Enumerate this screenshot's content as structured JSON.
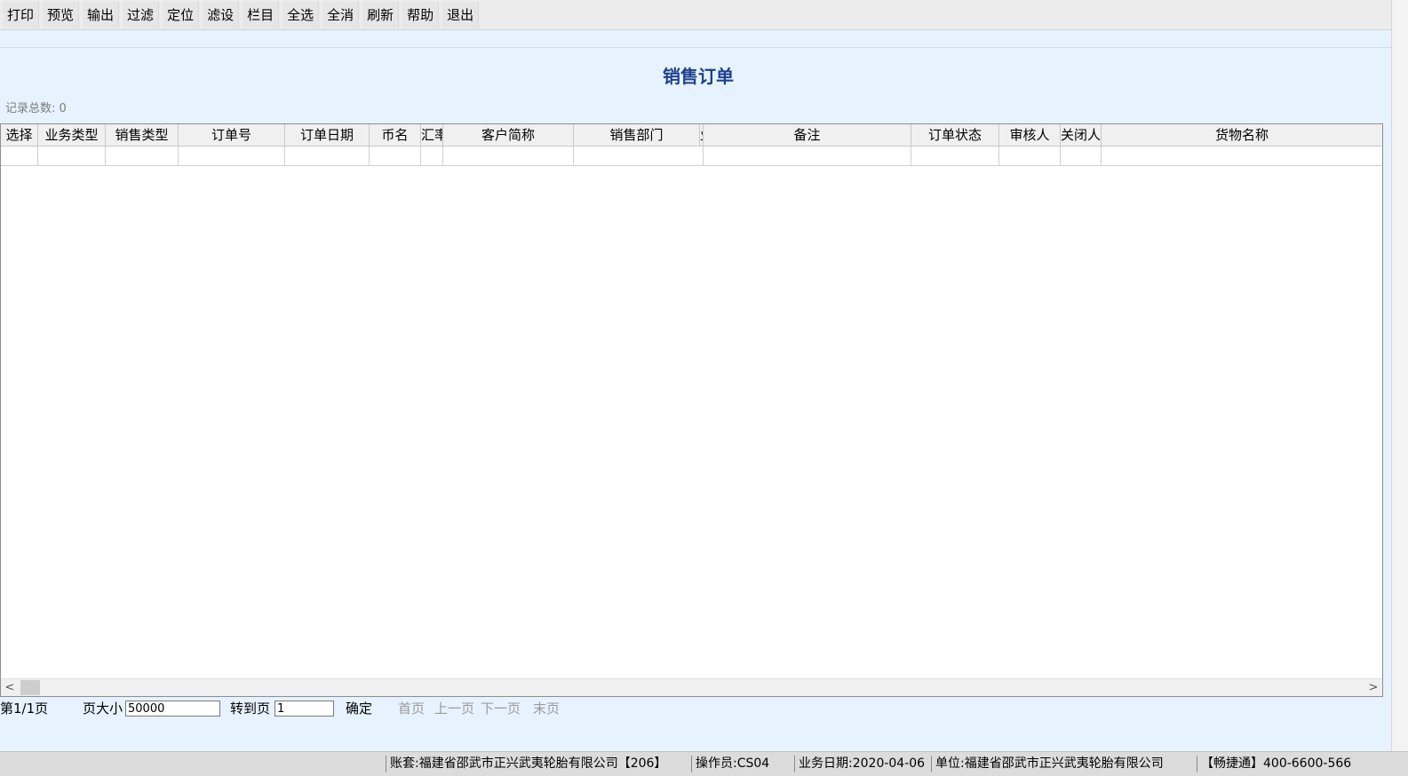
{
  "toolbar": {
    "buttons": [
      "打印",
      "预览",
      "输出",
      "过滤",
      "定位",
      "滤设",
      "栏目",
      "全选",
      "全消",
      "刷新",
      "帮助",
      "退出"
    ]
  },
  "title": "销售订单",
  "record_count_label": "记录总数: 0",
  "grid": {
    "columns": [
      "选择",
      "业务类型",
      "销售类型",
      "订单号",
      "订单日期",
      "币名",
      "汇率",
      "客户简称",
      "销售部门",
      "业务员",
      "备注",
      "订单状态",
      "审核人",
      "关闭人",
      "货物名称"
    ]
  },
  "scrollbar": {
    "left_arrow": "<",
    "right_arrow": ">"
  },
  "pager": {
    "page_info": "第1/1页",
    "page_size_label": "页大小",
    "page_size_value": "50000",
    "goto_label": "转到页",
    "goto_value": "1",
    "confirm_label": "确定",
    "first_label": "首页",
    "prev_label": "上一页",
    "next_label": "下一页",
    "last_label": "末页"
  },
  "statusbar": {
    "account": "账套:福建省邵武市正兴武夷轮胎有限公司【206】",
    "operator": "操作员:CS04",
    "business_date": "业务日期:2020-04-06",
    "unit": "单位:福建省邵武市正兴武夷轮胎有限公司",
    "hotline": "【畅捷通】400-6600-566"
  }
}
